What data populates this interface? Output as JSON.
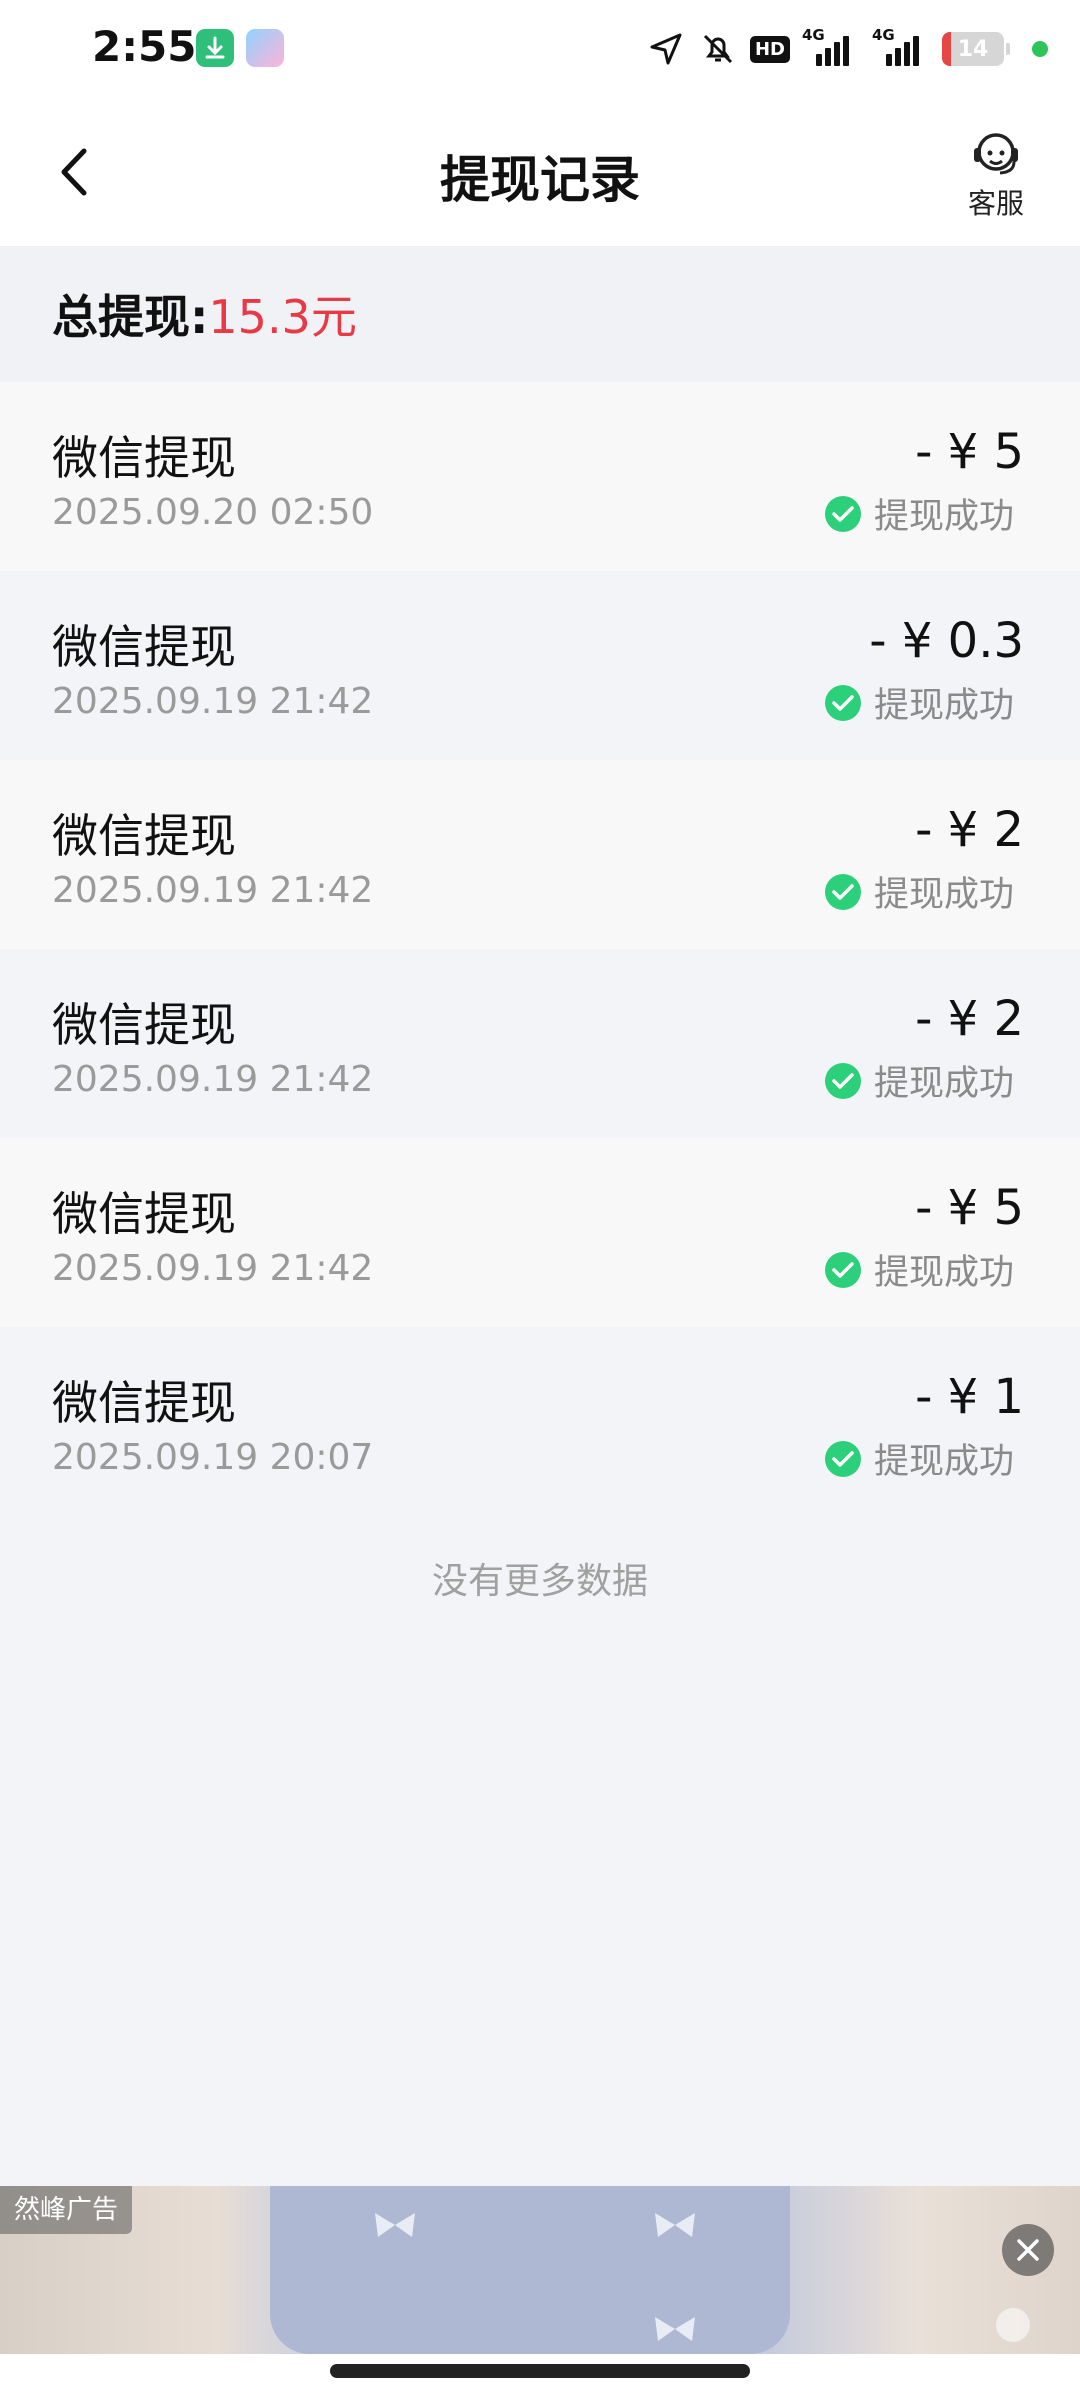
{
  "status_bar": {
    "time": "2:55",
    "battery": "14",
    "network_1": "4G",
    "network_2": "4G",
    "hd_label": "HD"
  },
  "header": {
    "title": "提现记录",
    "customer_service_label": "客服"
  },
  "summary": {
    "label": "总提现:",
    "amount": "15.3元"
  },
  "records": [
    {
      "title": "微信提现",
      "time": "2025.09.20 02:50",
      "amount": "- ¥ 5",
      "status": "提现成功"
    },
    {
      "title": "微信提现",
      "time": "2025.09.19 21:42",
      "amount": "- ¥ 0.3",
      "status": "提现成功"
    },
    {
      "title": "微信提现",
      "time": "2025.09.19 21:42",
      "amount": "- ¥ 2",
      "status": "提现成功"
    },
    {
      "title": "微信提现",
      "time": "2025.09.19 21:42",
      "amount": "- ¥ 2",
      "status": "提现成功"
    },
    {
      "title": "微信提现",
      "time": "2025.09.19 21:42",
      "amount": "- ¥ 5",
      "status": "提现成功"
    },
    {
      "title": "微信提现",
      "time": "2025.09.19 20:07",
      "amount": "- ¥ 1",
      "status": "提现成功"
    }
  ],
  "footer_text": "没有更多数据",
  "ad": {
    "tag": "然峰广告"
  },
  "colors": {
    "accent_red": "#e83a45",
    "success_green": "#2ccf7a",
    "background": "#f3f4f8"
  }
}
